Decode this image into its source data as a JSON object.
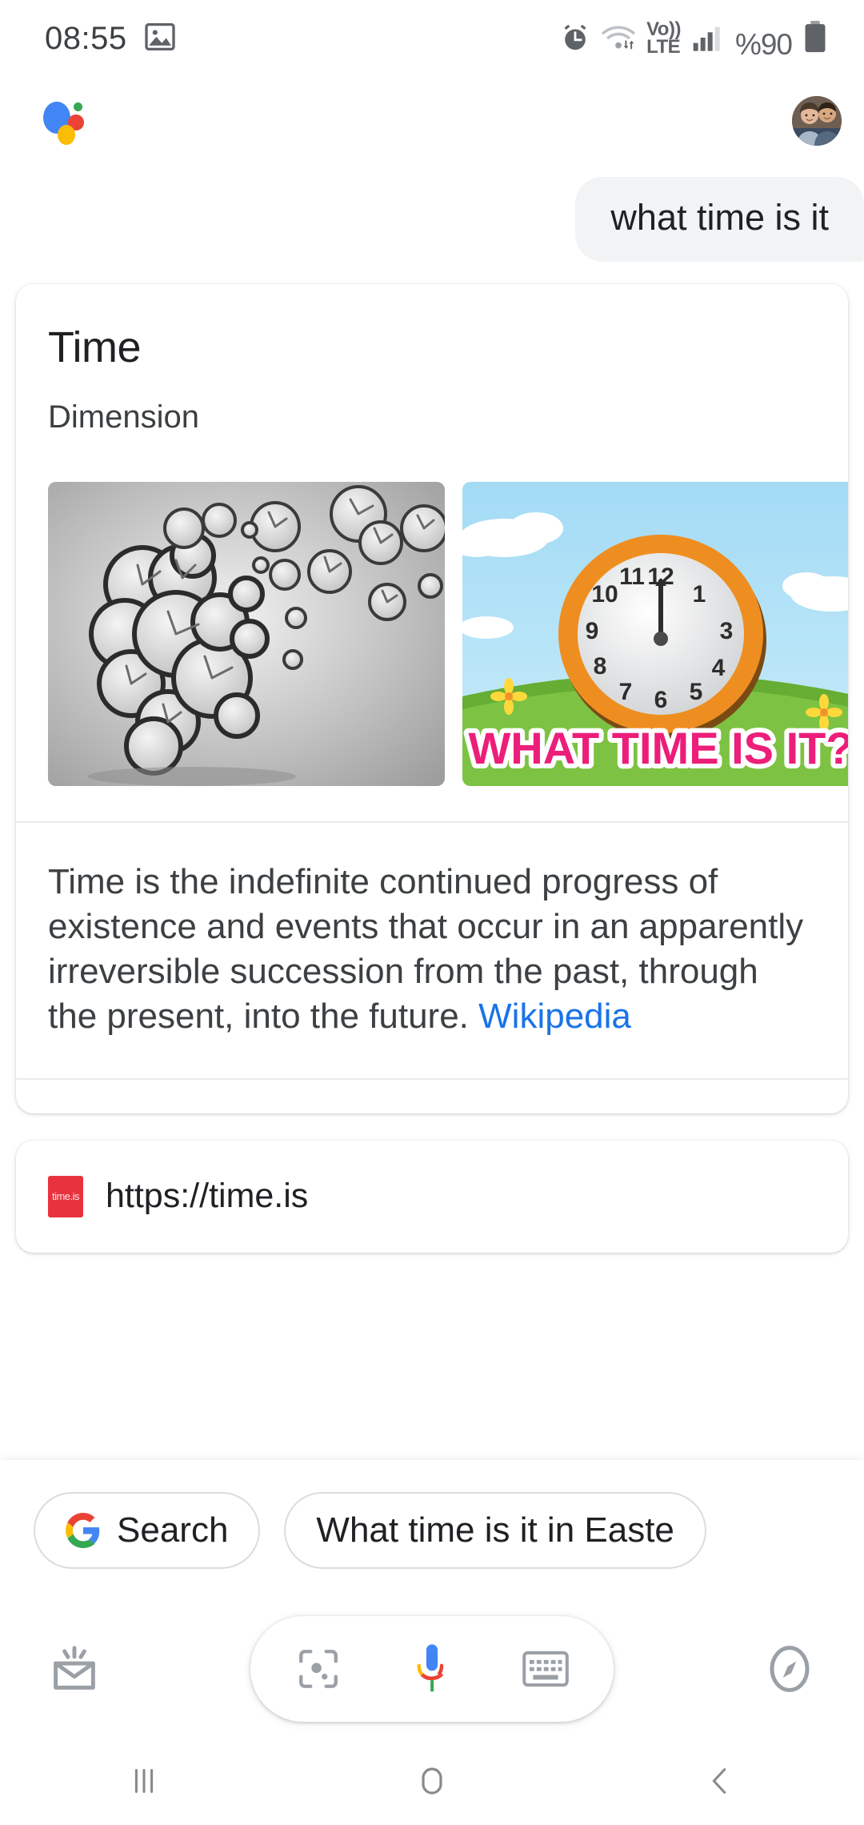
{
  "statusbar": {
    "time": "08:55",
    "battery_percent": "%90",
    "network_label_top": "Vo))",
    "network_label_bottom": "LTE",
    "icons": [
      "gallery-icon",
      "alarm-icon",
      "wifi-icon",
      "volte-icon",
      "signal-icon",
      "battery-icon"
    ]
  },
  "header": {
    "logo": "google-assistant-logo",
    "avatar": "user-avatar"
  },
  "conversation": {
    "user_query": "what time is it"
  },
  "knowledge_card": {
    "title": "Time",
    "subtitle": "Dimension",
    "images": [
      {
        "name": "clocks-head-image",
        "alt": "Head silhouette made of clocks"
      },
      {
        "name": "what-time-is-it-image",
        "alt": "Cartoon clock on grass",
        "caption": "WHAT TIME IS IT?"
      }
    ],
    "description": "Time is the indefinite continued progress of existence and events that occur in an apparently irreversible succession from the past, through the present, into the future.",
    "source_label": "Wikipedia",
    "source_color": "#1a73e8"
  },
  "url_card": {
    "favicon_glyph": "time.is",
    "url": "https://time.is"
  },
  "suggestions": {
    "chips": [
      {
        "name": "chip-search",
        "label": "Search",
        "icon": "google-g-icon"
      },
      {
        "name": "chip-eastern-time",
        "label": "What time is it in Easte",
        "icon": null
      }
    ]
  },
  "action_bar": {
    "left_icon": "updates-inbox-icon",
    "right_icon": "explore-compass-icon",
    "pill_items": [
      {
        "name": "lens-icon"
      },
      {
        "name": "google-mic-icon"
      },
      {
        "name": "keyboard-icon"
      }
    ]
  },
  "navbar": {
    "recents": "recents-icon",
    "home": "home-icon",
    "back": "back-icon"
  },
  "colors": {
    "google_blue": "#4285F4",
    "google_red": "#EA4335",
    "google_yellow": "#FBBC05",
    "google_green": "#34A853",
    "link_blue": "#1a73e8",
    "bubble_bg": "#f1f3f4"
  }
}
